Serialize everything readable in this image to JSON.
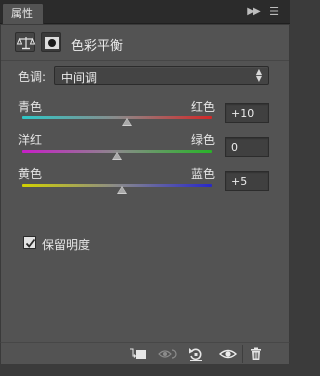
{
  "panel": {
    "tab_label": "属性",
    "title": "色彩平衡"
  },
  "tone": {
    "label": "色调:",
    "selected": "中间调"
  },
  "sliders": [
    {
      "left_label": "青色",
      "right_label": "红色",
      "value": "+10",
      "level": 10
    },
    {
      "left_label": "洋红",
      "right_label": "绿色",
      "value": "0",
      "level": 0
    },
    {
      "left_label": "黄色",
      "right_label": "蓝色",
      "value": "+5",
      "level": 5
    }
  ],
  "preserve_luminosity": {
    "label": "保留明度",
    "checked": true
  },
  "colors": {
    "panel_bg": "#535353",
    "cyan": "#2fc8c8",
    "red": "#d22828",
    "magenta": "#c81ec8",
    "green": "#28b428",
    "yellow": "#d2d200",
    "blue": "#2828c8"
  },
  "icons": [
    "double-chevron-right-icon",
    "menu-icon",
    "balance-scale-icon",
    "layer-mask-icon",
    "clip-to-layer-icon",
    "view-previous-state-icon",
    "reset-icon",
    "visibility-eye-icon",
    "trash-icon"
  ]
}
